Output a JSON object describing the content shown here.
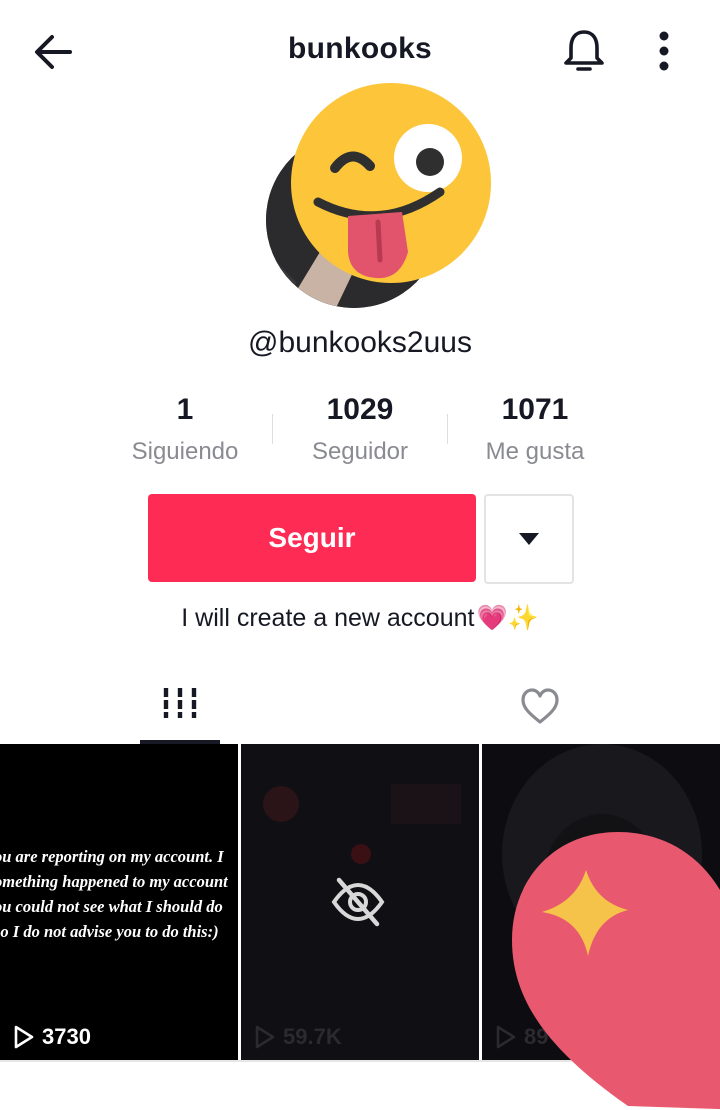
{
  "header": {
    "title": "bunkooks",
    "back_icon": "arrow-left-icon",
    "bell_icon": "bell-icon",
    "more_icon": "more-vertical-icon"
  },
  "profile": {
    "handle": "@bunkooks2uus",
    "bio": "I will create a new account",
    "bio_emoji": "💗✨"
  },
  "stats": [
    {
      "value": "1",
      "label": "Siguiendo"
    },
    {
      "value": "1029",
      "label": "Seguidor"
    },
    {
      "value": "1071",
      "label": "Me gusta"
    }
  ],
  "actions": {
    "follow_label": "Seguir",
    "dropdown_icon": "triangle-down-icon"
  },
  "tabs": [
    {
      "name": "videos",
      "icon": "grid-icon",
      "active": true
    },
    {
      "name": "liked",
      "icon": "heart-outline-icon",
      "active": false
    }
  ],
  "videos": [
    {
      "caption_lines": [
        "ou are reporting on my account. I",
        "omething happened to my account",
        "ou could not see what I should do",
        "so I do not advise you to do this:)"
      ],
      "views": "3730"
    },
    {
      "views": "59.7K",
      "private": true
    },
    {
      "views": "89"
    }
  ],
  "colors": {
    "accent": "#fe2c55",
    "text": "#161823",
    "muted": "#8a8b91"
  }
}
